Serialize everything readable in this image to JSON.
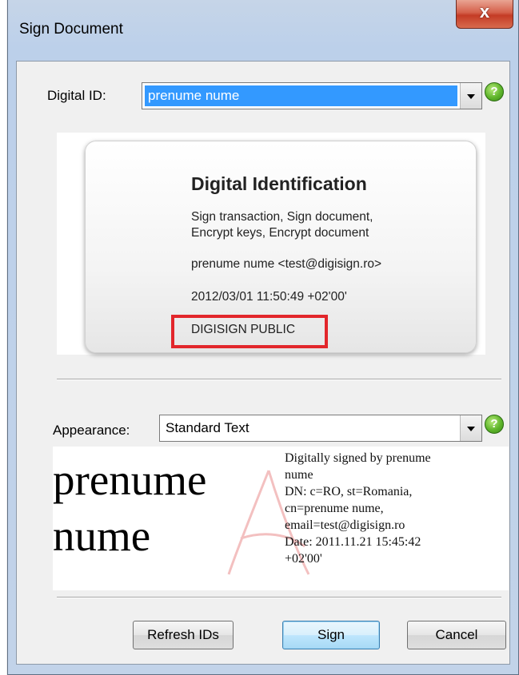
{
  "window": {
    "title": "Sign Document",
    "close_glyph": "x"
  },
  "digital_id": {
    "label": "Digital ID:",
    "value": "prenume nume",
    "help_glyph": "?"
  },
  "card": {
    "title": "Digital Identification",
    "usage_line1": "Sign transaction, Sign document,",
    "usage_line2": "Encrypt keys, Encrypt document",
    "subject": "prenume nume <test@digisign.ro>",
    "expiry": "2012/03/01 11:50:49 +02'00'",
    "issuer": "DIGISIGN PUBLIC",
    "highlight_color": "#e2262b"
  },
  "appearance": {
    "label": "Appearance:",
    "value": "Standard Text",
    "help_glyph": "?"
  },
  "preview": {
    "name_line1": "prenume",
    "name_line2": "nume",
    "details": [
      "Digitally signed by prenume",
      "nume",
      "DN: c=RO, st=Romania,",
      "cn=prenume nume,",
      "email=test@digisign.ro",
      "Date: 2011.11.21 15:45:42",
      "+02'00'"
    ]
  },
  "buttons": {
    "refresh": "Refresh IDs",
    "sign": "Sign",
    "cancel": "Cancel"
  }
}
